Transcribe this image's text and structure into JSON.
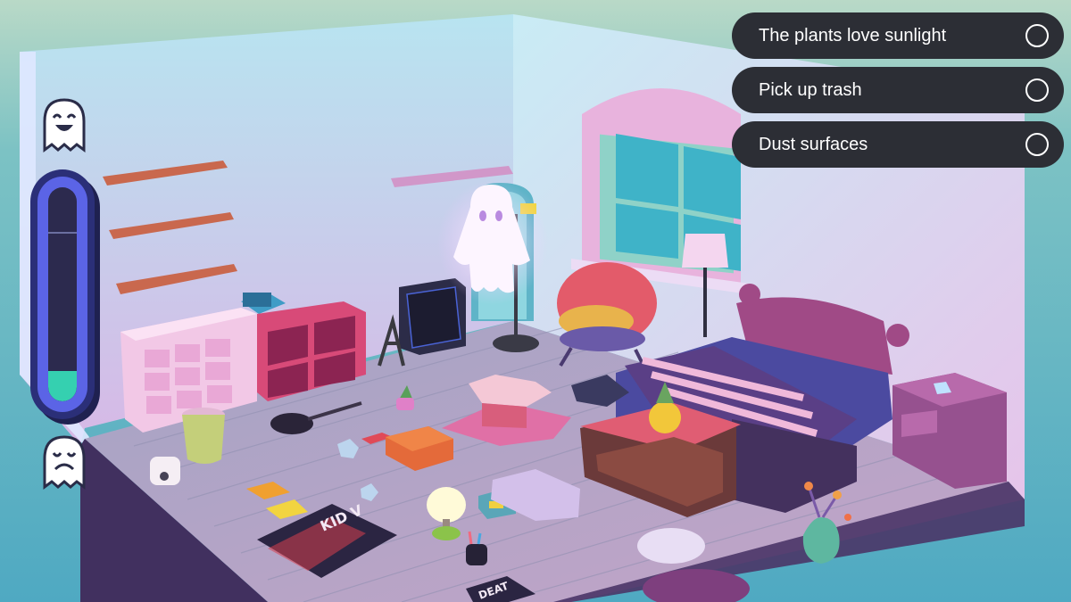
{
  "tasks": [
    {
      "label": "The plants love sunlight",
      "done": false
    },
    {
      "label": "Pick up trash",
      "done": false
    },
    {
      "label": "Dust surfaces",
      "done": false
    }
  ],
  "mood_meter": {
    "level": 0.14
  },
  "room_text": {
    "poster": "KID V",
    "rug": "DEAT"
  },
  "colors": {
    "panel": "#2c2e35",
    "meter_fill": "#35d0b0",
    "meter_frame": "#5b64e6"
  }
}
